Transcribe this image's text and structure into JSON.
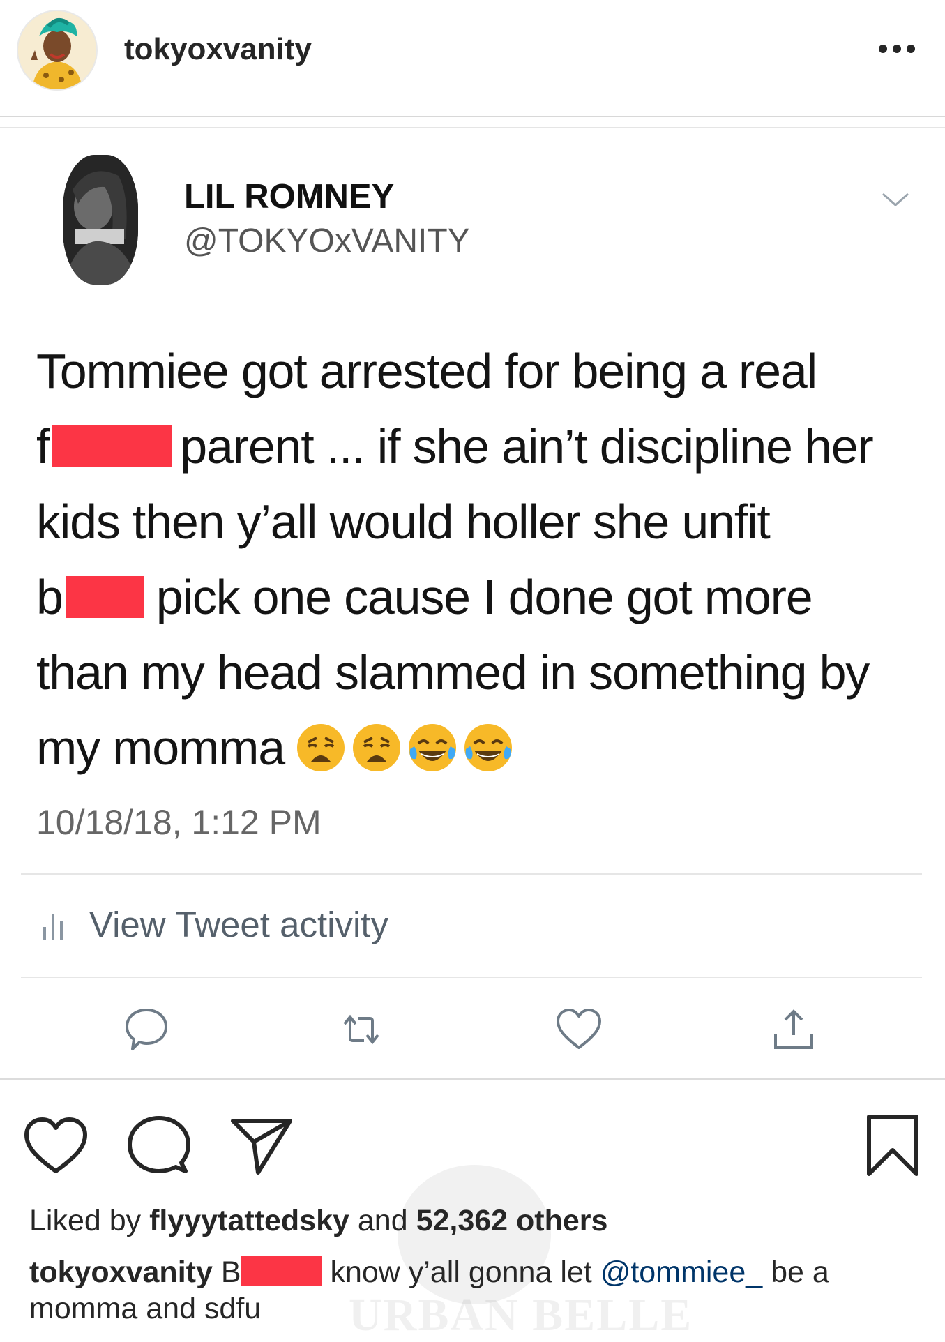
{
  "ig_post": {
    "username": "tokyoxvanity",
    "more_label": "more options"
  },
  "tweet": {
    "display_name": "LIL ROMNEY",
    "handle": "@TOKYOxVANITY",
    "lines": [
      {
        "pre": "Tommiee got arrested for being a real",
        "post": ""
      },
      {
        "pre": "f",
        "post": "parent ... if she ain’t discipline her"
      },
      {
        "pre": "kids then y’all would holler she unfit",
        "post": ""
      },
      {
        "pre": "b",
        "post": "pick one cause I done got more"
      },
      {
        "pre": "than my head slammed in something by",
        "post": ""
      },
      {
        "pre": "my momma",
        "post": ""
      }
    ],
    "emojis": [
      "weary-face",
      "weary-face",
      "tears-of-joy-face",
      "tears-of-joy-face"
    ],
    "timestamp": "10/18/18, 1:12 PM",
    "activity_label": "View Tweet activity"
  },
  "likes": {
    "prefix": "Liked by ",
    "user": "flyyytattedsky",
    "middle": " and ",
    "count": "52,362 others"
  },
  "caption": {
    "username": "tokyoxvanity",
    "text_before": " B",
    "text_after": " know y’all gonna let ",
    "mention": "@tommiee_",
    "text_end": " be a momma and sdfu"
  },
  "watermark": "URBAN BELLE",
  "colors": {
    "redaction": "#fc3545",
    "mention": "#003569"
  }
}
